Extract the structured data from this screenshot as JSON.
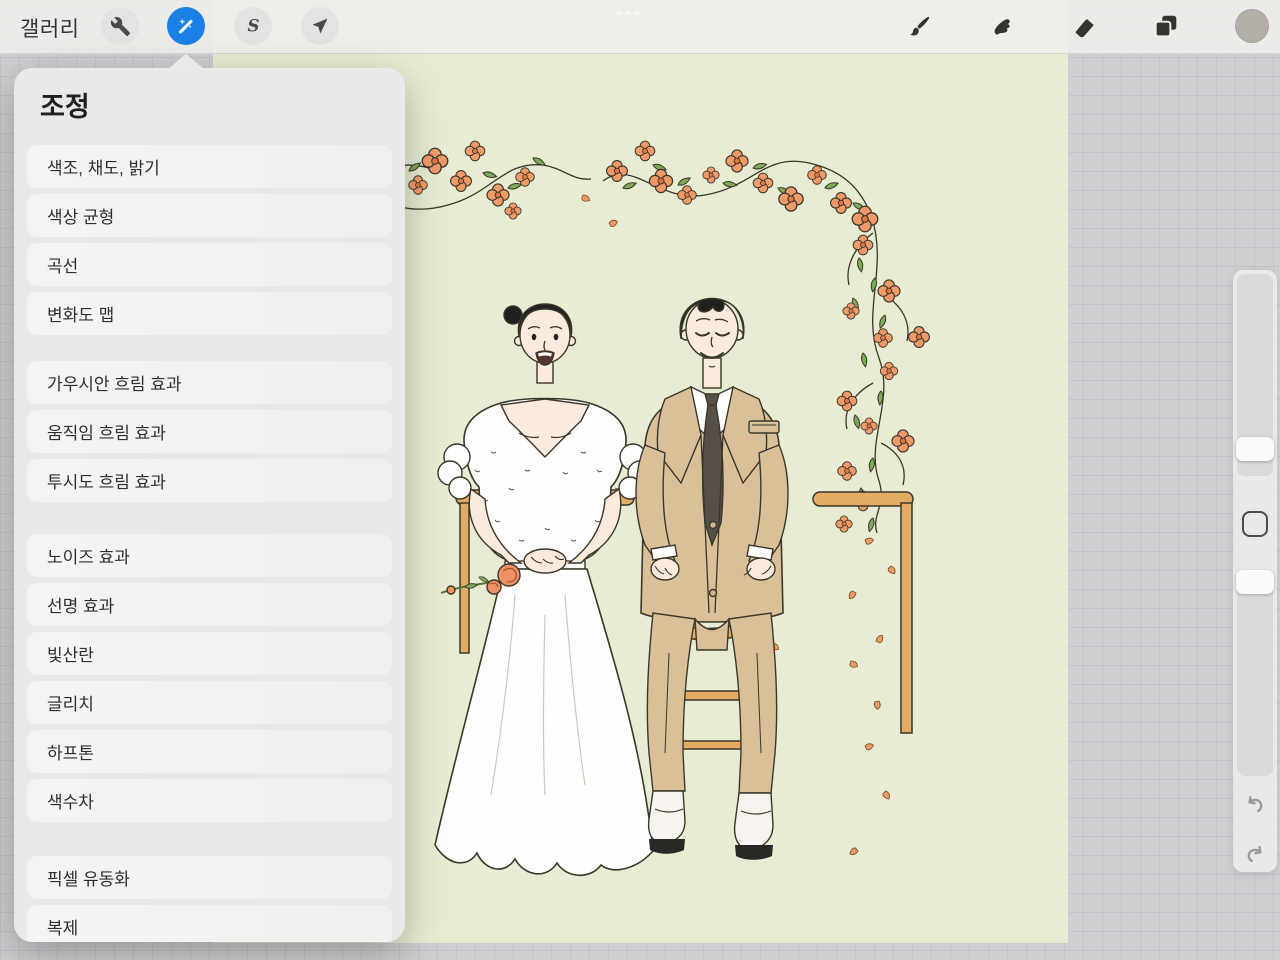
{
  "toolbar": {
    "gallery_label": "갤러리",
    "active_tool_color": "#1a80e6",
    "color_swatch": "#b3afa7",
    "left_tools": [
      {
        "name": "actions-wrench",
        "active": false
      },
      {
        "name": "adjustments-magic-wand",
        "active": true
      },
      {
        "name": "selection-s",
        "active": false
      },
      {
        "name": "transform-arrow",
        "active": false
      }
    ],
    "right_tools": [
      "brush",
      "smudge",
      "eraser",
      "layers",
      "color-swatch"
    ],
    "selection_letter": "S"
  },
  "menu": {
    "title": "조정",
    "groups": [
      [
        "색조, 채도, 밝기",
        "색상 균형",
        "곡선",
        "변화도 맵"
      ],
      [
        "가우시안 흐림 효과",
        "움직임 흐림 효과",
        "투시도 흐림 효과"
      ],
      [
        "노이즈 효과",
        "선명 효과",
        "빛산란",
        "글리치",
        "하프톤",
        "색수차"
      ],
      [
        "픽셀 유동화",
        "복제"
      ]
    ]
  },
  "sidebar": {
    "controls": [
      "brush-size-slider",
      "modify-button",
      "opacity-slider",
      "undo-button",
      "redo-button"
    ]
  },
  "canvas": {
    "background_color": "#e7ecd3",
    "description": "Line-art illustration of a seated wedding couple: bride in white lace dress holding a small orange rose, groom in beige suit with dark tie, wooden chairs, orange flower garland across the top with a vine cascading down the right and falling petals",
    "palette": {
      "outline": "#3a372a",
      "skin": "#fcebdd",
      "hair": "#22201e",
      "suit": "#d9c099",
      "tie": "#565049",
      "dress": "#fdfdfc",
      "wood": "#e3ab63",
      "flower": "#f09a6a",
      "flower_center": "#e0763f",
      "leaf": "#7cab58"
    }
  }
}
